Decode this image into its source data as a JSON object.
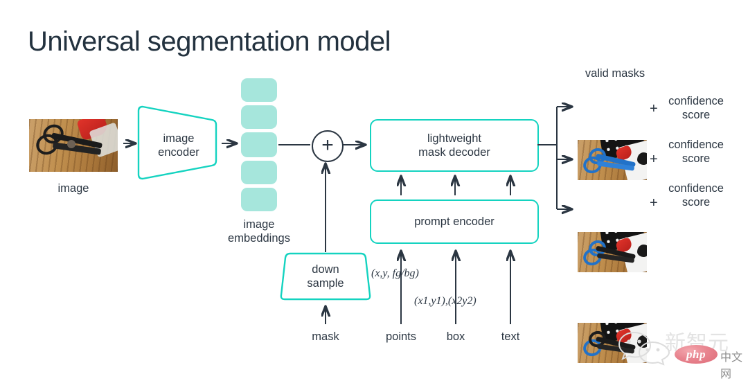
{
  "page": {
    "title": "Universal segmentation model",
    "background": "#ffffff",
    "accent_teal": "#14d3c0",
    "chip_teal": "#a6e6dc",
    "ink": "#2b3642"
  },
  "diagram": {
    "input": {
      "label": "image",
      "thumb_name": "input-photo-scissors-on-cutting-board"
    },
    "image_encoder": {
      "line1": "image",
      "line2": "encoder",
      "shape": "trapezoid"
    },
    "image_embeddings": {
      "line1": "image",
      "line2": "embeddings",
      "chip_count": 5
    },
    "sum_node": {
      "symbol": "+",
      "name": "plus-circle-junction"
    },
    "mask_decoder": {
      "line1": "lightweight",
      "line2": "mask decoder"
    },
    "prompt_encoder": {
      "label": "prompt encoder"
    },
    "down_sample": {
      "line1": "down",
      "line2": "sample",
      "shape": "trapezoid"
    },
    "prompt_inputs": [
      {
        "label": "mask",
        "annotation": ""
      },
      {
        "label": "points",
        "annotation": "(x,y, fg/bg)"
      },
      {
        "label": "box",
        "annotation": "(x1,y1),(x2y2)"
      },
      {
        "label": "text",
        "annotation": ""
      }
    ],
    "outputs": {
      "header": "valid masks",
      "plus_symbol": "+",
      "items": [
        {
          "score_line1": "confidence",
          "score_line2": "score",
          "mask_name": "mask-full-scissors"
        },
        {
          "score_line1": "confidence",
          "score_line2": "score",
          "mask_name": "mask-scissors-handles"
        },
        {
          "score_line1": "confidence",
          "score_line2": "score",
          "mask_name": "mask-single-handle"
        }
      ]
    }
  },
  "watermark": {
    "brand_cn": "新智元",
    "php_text": "php",
    "site_cn": "中文网"
  }
}
